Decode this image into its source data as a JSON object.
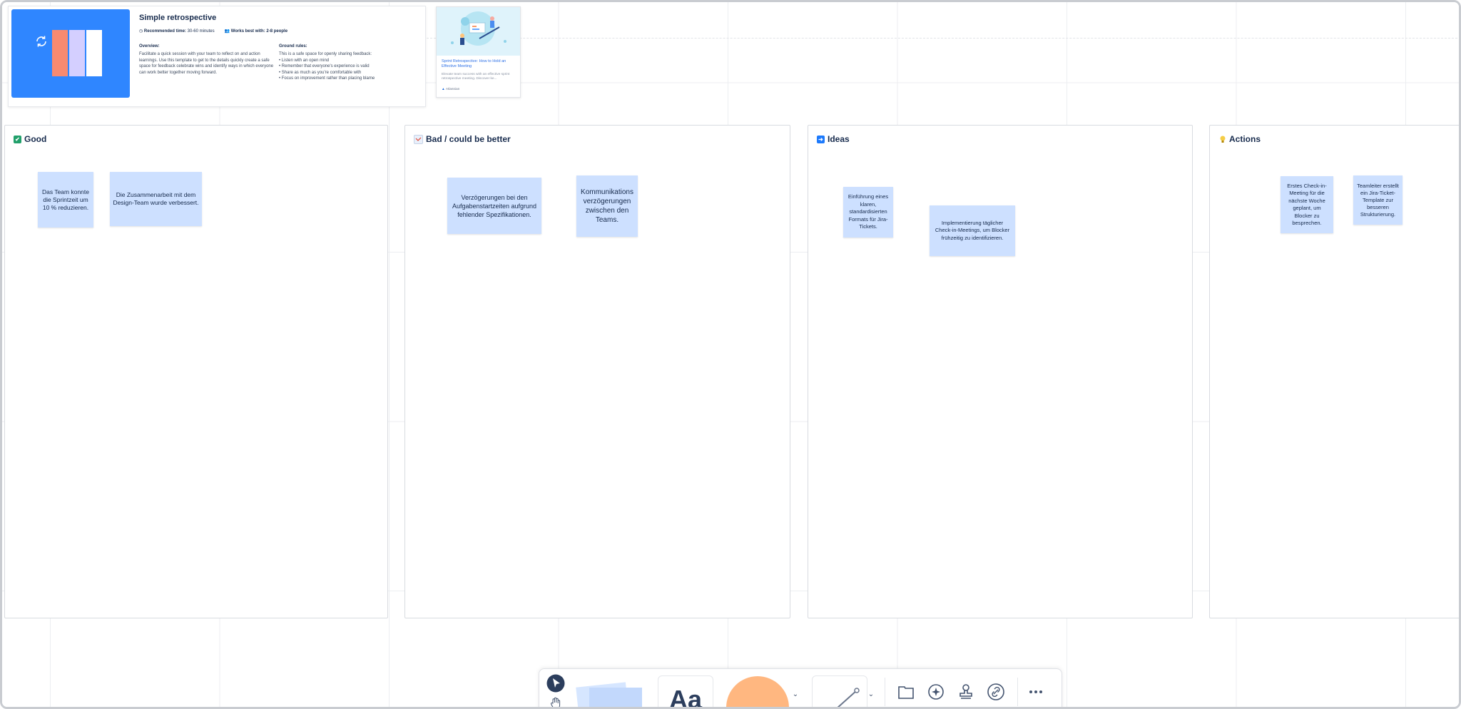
{
  "template": {
    "title": "Simple retrospective",
    "time_label": "Recommended time:",
    "time_value": "30-60 minutes",
    "people_label": "Works best with:",
    "people_value": "2-8 people",
    "overview_head": "Overview:",
    "overview_text": "Facilitate a quick session with your team to reflect on and action learnings. Use this template to get to the details quickly create a safe space for feedback celebrate wins and identify ways in which everyone can work better together moving forward.",
    "rules_head": "Ground rules:",
    "rules": [
      "This is a safe space for openly sharing feedback:",
      "• Listen with an open mind",
      "• Remember that everyone's experience is valid",
      "• Share as much as you're comfortable with",
      "• Focus on improvement rather than placing blame"
    ]
  },
  "article": {
    "title": "Sprint Retrospective: How to Hold an Effective Meeting",
    "description": "Elevate team success with an effective sprint retrospective meeting. Discover ke...",
    "source": "Atlassian"
  },
  "columns": [
    {
      "title": "Good",
      "icon": "check-icon",
      "icon_color": "#22a06b",
      "icon_glyph": "✔",
      "stickies": [
        "Das Team konnte die Sprintzeit um 10 % reduzieren.",
        "Die Zusammenarbeit mit dem Design-Team wurde verbessert."
      ]
    },
    {
      "title": "Bad / could be better",
      "icon": "chart-decreasing-icon",
      "icon_color": "#e9f0fb",
      "icon_glyph": "",
      "stickies": [
        "Verzögerungen bei den Aufgabenstartzeiten aufgrund fehlender Spezifikationen.",
        "Kommunikations verzögerungen zwischen den Teams."
      ]
    },
    {
      "title": "Ideas",
      "icon": "arrow-right-icon",
      "icon_color": "#1d7afc",
      "icon_glyph": "➜",
      "stickies": [
        "Einführung eines klaren, standardisierten Formats für Jira-Tickets.",
        "Implementierung täglicher Check-in-Meetings, um Blocker frühzeitig zu identifizieren."
      ]
    },
    {
      "title": "Actions",
      "icon": "lightbulb-icon",
      "icon_color": "#f5cd47",
      "icon_glyph": "",
      "stickies": [
        "Erstes Check-in-Meeting für die nächste Woche geplant, um Blocker zu besprechen.",
        "Teamleiter erstellt ein Jira-Ticket-Template zur besseren Strukturierung."
      ]
    }
  ],
  "toolbar": {
    "text_tool_label": "Aa",
    "tools": [
      "select-tool",
      "hand-tool",
      "sticky-note-tool",
      "text-tool",
      "shape-tool",
      "line-tool",
      "section-tool",
      "ai-tool",
      "stamp-tool",
      "link-tool",
      "more-tool"
    ],
    "shape_color": "#ffb780",
    "select_color": "#2c3e5d"
  }
}
